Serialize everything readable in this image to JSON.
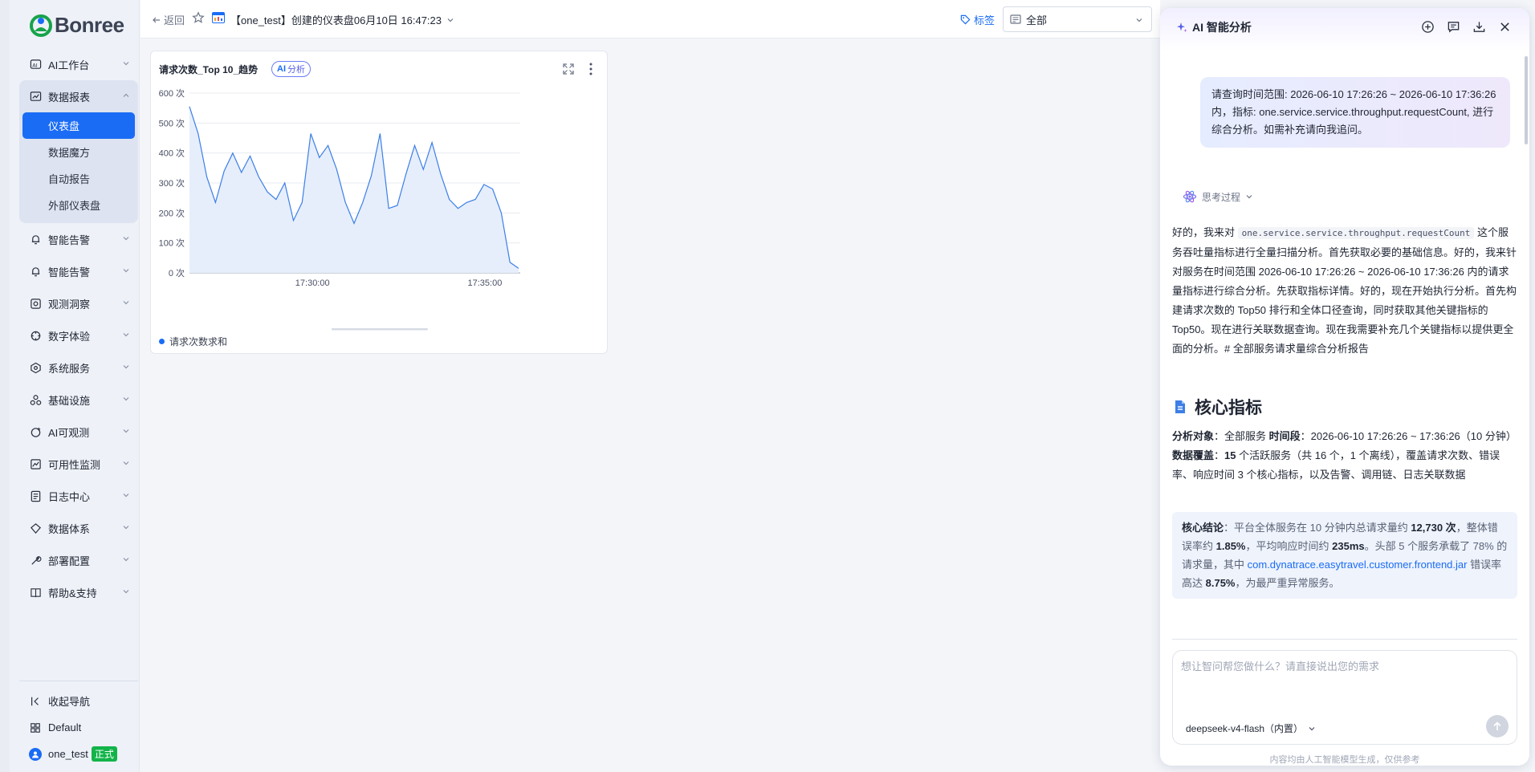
{
  "sidebar": {
    "brand": "Bonree",
    "items": [
      {
        "label": "AI工作台",
        "icon": "ai-workbench-icon"
      },
      {
        "label": "数据报表",
        "icon": "chart-report-icon"
      },
      {
        "label": "智能告警",
        "icon": "alert-icon"
      },
      {
        "label": "智能告警",
        "icon": "alert-icon"
      },
      {
        "label": "观测洞察",
        "icon": "insight-icon"
      },
      {
        "label": "数字体验",
        "icon": "experience-icon"
      },
      {
        "label": "系统服务",
        "icon": "service-icon"
      },
      {
        "label": "基础设施",
        "icon": "infra-icon"
      },
      {
        "label": "AI可观测",
        "icon": "ai-observe-icon"
      },
      {
        "label": "可用性监测",
        "icon": "availability-icon"
      },
      {
        "label": "日志中心",
        "icon": "log-icon"
      },
      {
        "label": "数据体系",
        "icon": "data-system-icon"
      },
      {
        "label": "部署配置",
        "icon": "deploy-icon"
      },
      {
        "label": "帮助&支持",
        "icon": "help-icon"
      }
    ],
    "sub_items": [
      "仪表盘",
      "数据魔方",
      "自动报告",
      "外部仪表盘"
    ],
    "bottom": {
      "collapse": "收起导航",
      "workspace": "Default",
      "user": "one_test",
      "user_badge": "正式"
    }
  },
  "topbar": {
    "back": "返回",
    "dashboard_title": "【one_test】创建的仪表盘06月10日 16:47:23",
    "tag": "标签",
    "select_value": "全部"
  },
  "widget": {
    "title": "请求次数_Top 10_趋势",
    "ai_prefix": "AI",
    "ai_label": "分析"
  },
  "chart_data": {
    "type": "area",
    "title": "请求次数_Top 10_趋势",
    "ylim": [
      0,
      600
    ],
    "y_ticks": [
      "600 次",
      "500 次",
      "400 次",
      "300 次",
      "200 次",
      "100 次",
      "0 次"
    ],
    "x_ticks": [
      "17:30:00",
      "17:35:00"
    ],
    "series": [
      {
        "name": "请求次数求和",
        "values": [
          555,
          465,
          320,
          235,
          340,
          400,
          335,
          390,
          320,
          270,
          245,
          300,
          175,
          235,
          465,
          385,
          425,
          345,
          235,
          165,
          235,
          325,
          465,
          215,
          225,
          330,
          425,
          345,
          435,
          330,
          245,
          215,
          235,
          245,
          295,
          280,
          200,
          35,
          15
        ]
      }
    ],
    "grid": true,
    "legend": "bottom-left"
  },
  "ai_panel": {
    "title": "AI 智能分析",
    "user_message": "请查询时间范围: 2026-06-10 17:26:26 ~ 2026-06-10 17:36:26内，指标: one.service.service.throughput.requestCount, 进行综合分析。如需补充请向我追问。",
    "think_label": "思考过程",
    "reply_pre": "好的，我来对 ",
    "reply_code": "one.service.service.throughput.requestCount",
    "reply_post": " 这个服务吞吐量指标进行全量扫描分析。首先获取必要的基础信息。好的，我来针对服务在时间范围 2026-06-10 17:26:26 ~ 2026-06-10 17:36:26 内的请求量指标进行综合分析。先获取指标详情。好的，现在开始执行分析。首先构建请求次数的 Top50 排行和全体口径查询，同时获取其他关键指标的 Top50。现在进行关联数据查询。现在我需要补充几个关键指标以提供更全面的分析。# 全部服务请求量综合分析报告",
    "heading": "核心指标",
    "meta": {
      "k1": "分析对象",
      "v1": "：全部服务 ",
      "k2": "时间段",
      "v2": "：2026-06-10 17:26:26 ~ 17:36:26（10 分钟） ",
      "k3": "数据覆盖",
      "v3a": "：",
      "v3b": "15",
      "v3c": " 个活跃服务（共 16 个，1 个离线），覆盖请求次数、错误率、响应时间 3 个核心指标，以及告警、调用链、日志关联数据"
    },
    "summary": {
      "k": "核心结论",
      "t1": "：平台全体服务在 10 分钟内总请求量约 ",
      "n1": "12,730 次",
      "t2": "，整体错误率约 ",
      "n2": "1.85%",
      "t3": "，平均响应时间约 ",
      "n3": "235ms",
      "t4": "。头部 5 个服务承载了 78% 的请求量，其中 ",
      "link": "com.dynatrace.easytravel.customer.frontend.jar",
      "t5": " 错误率高达 ",
      "n4": "8.75%",
      "t6": "，为最严重异常服务。"
    },
    "input_placeholder": "想让智问帮您做什么？请直接说出您的需求",
    "model": "deepseek-v4-flash（内置）",
    "disclaimer": "内容均由人工智能模型生成，仅供参考"
  },
  "colors": {
    "accent": "#1a6cf5",
    "series_line": "#3d7fe6",
    "series_fill": "#e6eefc"
  }
}
